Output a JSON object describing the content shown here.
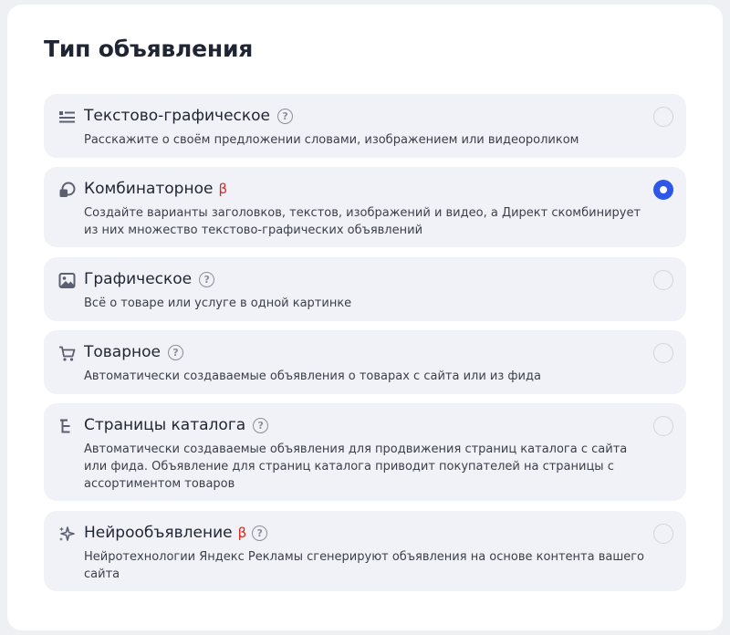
{
  "section": {
    "title": "Тип объявления"
  },
  "options": [
    {
      "title": "Текстово-графическое",
      "description": "Расскажите о своём предложении словами, изображением или видеороликом",
      "icon": "text-graphic-icon",
      "help": "?",
      "selected": false
    },
    {
      "title": "Комбинаторное",
      "beta": "β",
      "description": "Создайте варианты заголовков, текстов, изображений и видео, а Директ скомбинирует из них множество текстово-графических объявлений",
      "icon": "combinatorial-icon",
      "selected": true
    },
    {
      "title": "Графическое",
      "description": "Всё о товаре или услуге в одной картинке",
      "icon": "image-icon",
      "help": "?",
      "selected": false
    },
    {
      "title": "Товарное",
      "description": "Автоматически создаваемые объявления о товарах с сайта или из фида",
      "icon": "cart-icon",
      "help": "?",
      "selected": false
    },
    {
      "title": "Страницы каталога",
      "description": "Автоматически создаваемые объявления для продвижения страниц каталога с сайта или фида. Объявление для страниц каталога приводит покупателей на страницы с ассортиментом товаров",
      "icon": "catalog-tree-icon",
      "help": "?",
      "selected": false
    },
    {
      "title": "Нейрообъявление",
      "beta": "β",
      "description": "Нейротехнологии Яндекс Рекламы сгенерируют объявления на основе контента вашего сайта",
      "icon": "sparkle-icon",
      "help": "?",
      "selected": false
    }
  ],
  "colors": {
    "accent": "#2c57e8",
    "beta": "#d72b1f",
    "card_bg": "#f0f2f7",
    "page_bg": "#eef0f4"
  }
}
